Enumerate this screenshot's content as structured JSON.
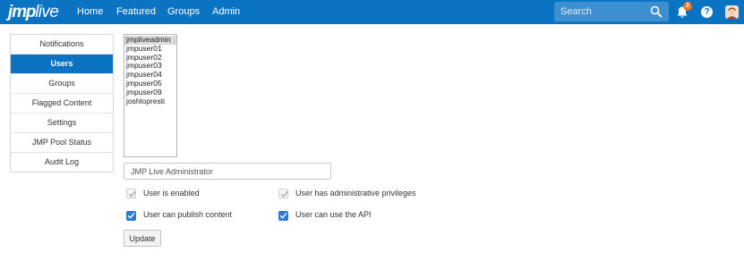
{
  "header": {
    "logo_bold": "jmp",
    "logo_light": "live",
    "nav": [
      "Home",
      "Featured",
      "Groups",
      "Admin"
    ],
    "search_placeholder": "Search",
    "notification_count": "2",
    "help_label": "?",
    "brand_color": "#0a73c2",
    "badge_color": "#e87722"
  },
  "sidebar": {
    "items": [
      {
        "label": "Notifications",
        "active": false
      },
      {
        "label": "Users",
        "active": true
      },
      {
        "label": "Groups",
        "active": false
      },
      {
        "label": "Flagged Content",
        "active": false
      },
      {
        "label": "Settings",
        "active": false
      },
      {
        "label": "JMP Pool Status",
        "active": false
      },
      {
        "label": "Audit Log",
        "active": false
      }
    ]
  },
  "users": {
    "list": [
      "jmpliveadmin",
      "jmpuser01",
      "jmpuser02",
      "jmpuser03",
      "jmpuser04",
      "jmpuser05",
      "jmpuser09",
      "joshlopresti"
    ],
    "selected": "jmpliveadmin"
  },
  "form": {
    "full_name": "JMP Live Administrator",
    "checkboxes": [
      {
        "label": "User is enabled",
        "checked": true,
        "disabled": true
      },
      {
        "label": "User has administrative privileges",
        "checked": true,
        "disabled": true
      },
      {
        "label": "User can publish content",
        "checked": true,
        "disabled": false
      },
      {
        "label": "User can use the API",
        "checked": true,
        "disabled": false
      }
    ],
    "update_label": "Update"
  }
}
